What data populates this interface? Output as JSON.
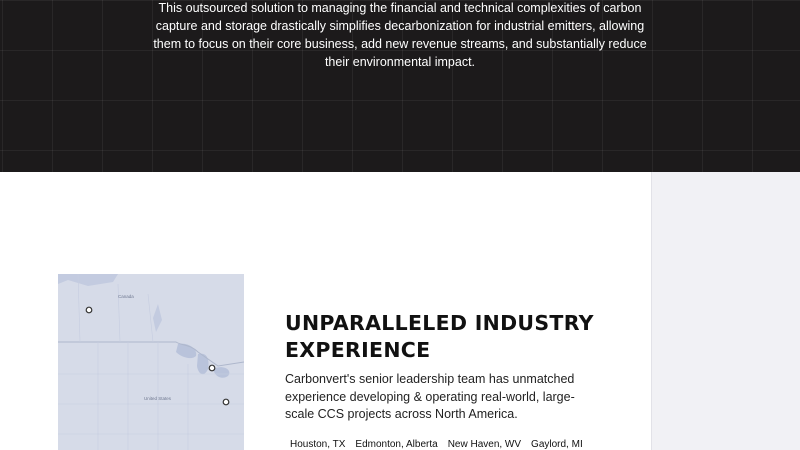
{
  "hero": {
    "description": "This outsourced solution to managing the financial and technical complexities of carbon capture and storage drastically simplifies decarbonization for industrial emitters, allowing them to focus on their core business, add new revenue streams, and substantially reduce their environmental impact."
  },
  "experience": {
    "title": "UNPARALLELED INDUSTRY EXPERIENCE",
    "body": "Carbonvert's senior leadership team has unmatched experience developing & operating real-world, large-scale CCS projects across North America.",
    "locations": [
      "Houston, TX",
      "Edmonton, Alberta",
      "New Haven, WV",
      "Gaylord, MI"
    ]
  },
  "map": {
    "labels": {
      "canada": "Canada",
      "united_states": "United States"
    },
    "marker_icon": "map-pin-circle-icon"
  },
  "colors": {
    "hero_background": "#1c1a1b",
    "side_panel": "#f1f1f5",
    "map_land": "#d6dbe8",
    "map_water": "#b9c3db"
  }
}
